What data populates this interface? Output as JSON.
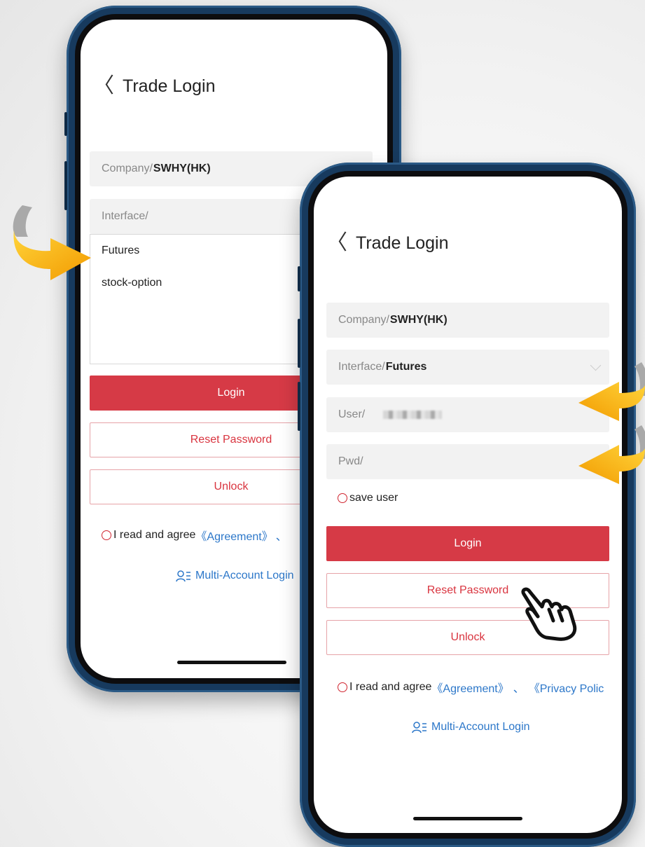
{
  "phone_back": {
    "title": "Trade Login",
    "company": {
      "label": "Company/",
      "value": "SWHY(HK)"
    },
    "interface": {
      "label": "Interface/",
      "value": ""
    },
    "dropdown_options": [
      "Futures",
      "stock-option"
    ],
    "login_label": "Login",
    "reset_label": "Reset Password",
    "unlock_label": "Unlock",
    "agree_text": "I read and agree ",
    "agreement_link": "《Agreement》",
    "separator": "、",
    "multi_account": "Multi-Account Login"
  },
  "phone_front": {
    "title": "Trade Login",
    "company": {
      "label": "Company/",
      "value": "SWHY(HK)"
    },
    "interface": {
      "label": "Interface/",
      "value": "Futures"
    },
    "user": {
      "label": "User/"
    },
    "pwd": {
      "label": "Pwd/"
    },
    "save_user": "save user",
    "login_label": "Login",
    "reset_label": "Reset Password",
    "unlock_label": "Unlock",
    "agree_text": "I read and agree ",
    "agreement_link": "《Agreement》",
    "separator": "、",
    "privacy_link": "《Privacy Polic",
    "multi_account": "Multi-Account Login"
  },
  "colors": {
    "accent_red": "#d63a46",
    "link_blue": "#2c77c9",
    "frame_blue": "#173a5e",
    "arrow_yellow": "#f7b500"
  },
  "icons": [
    "chevron-left-icon",
    "chevron-down-icon",
    "radio-icon",
    "multi-account-icon",
    "curved-arrow-icon",
    "hand-pointer-icon"
  ]
}
